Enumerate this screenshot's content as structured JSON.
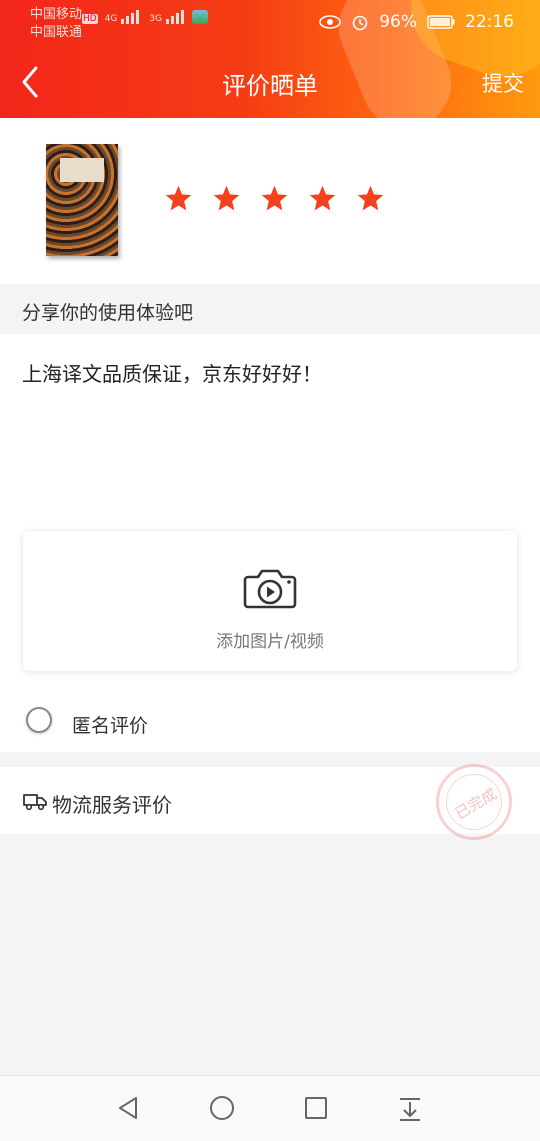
{
  "status_bar": {
    "carrier1": "中国移动",
    "carrier2": "中国联通",
    "net1": "4G",
    "net2": "3G",
    "battery": "96%",
    "time": "22:16"
  },
  "header": {
    "title": "评价晒单",
    "submit_label": "提交",
    "back_icon": "back-chevron-icon"
  },
  "product": {
    "rating": 5,
    "max_rating": 5,
    "star_color": "#f2411d"
  },
  "review": {
    "prompt": "分享你的使用体验吧",
    "text": "上海译文品质保证，京东好好好！"
  },
  "upload": {
    "label": "添加图片/视频",
    "icon": "camera-video-icon"
  },
  "anonymous": {
    "label": "匿名评价",
    "checked": false
  },
  "logistics": {
    "label": "物流服务评价",
    "icon": "truck-icon"
  },
  "stamp": {
    "text": "已完成"
  },
  "colors": {
    "accent": "#f3261a",
    "accent_end": "#ff9a0e"
  }
}
